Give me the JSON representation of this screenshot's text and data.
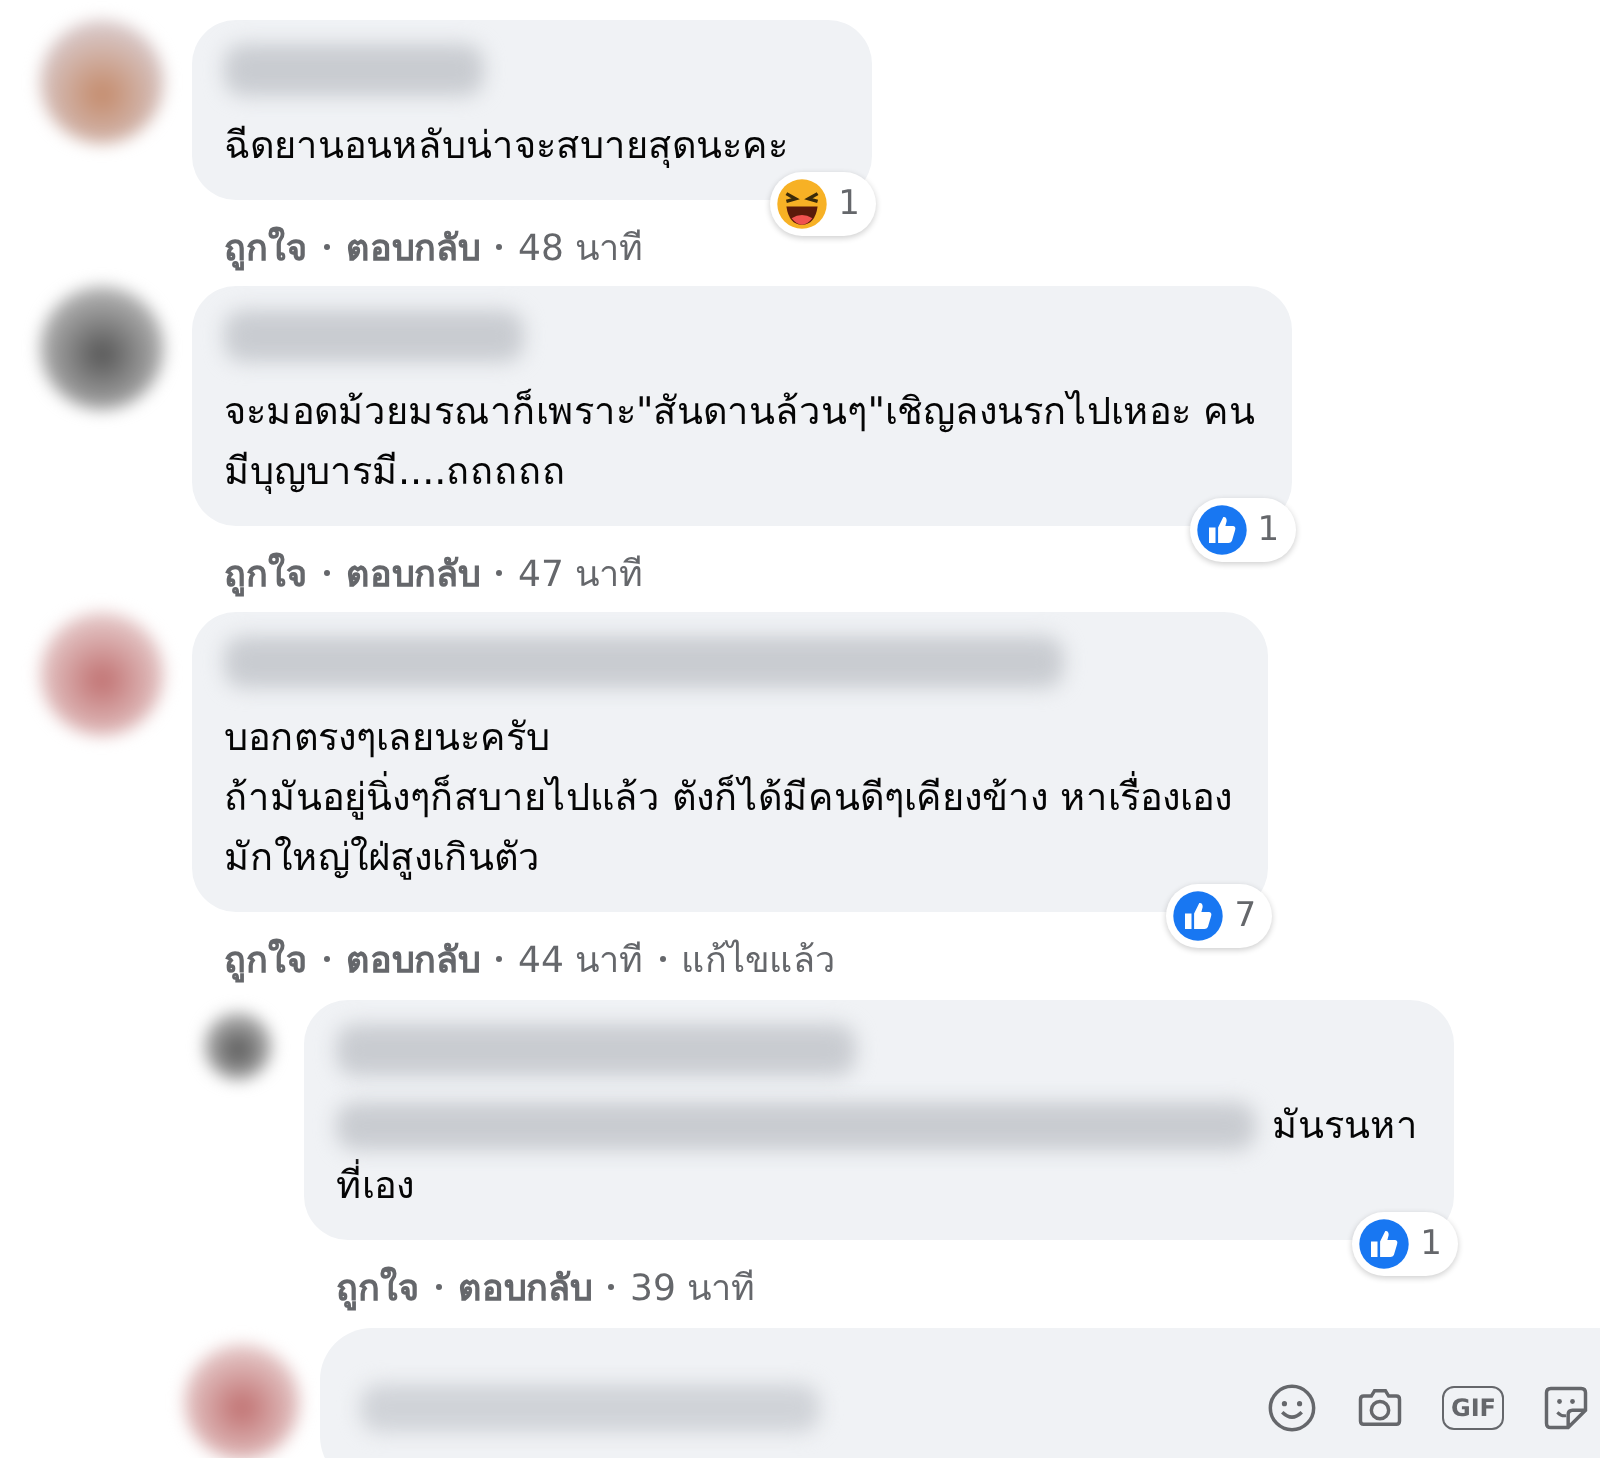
{
  "comments": [
    {
      "text_lines": [
        "ฉีดยานอนหลับน่าจะสบายสุดนะคะ"
      ],
      "reaction": {
        "kind": "haha",
        "count": "1"
      },
      "actions": [
        "ถูกใจ",
        "ตอบกลับ",
        "48 นาที"
      ]
    },
    {
      "text_lines": [
        "จะมอดม้วยมรณาก็เพราะ\"สันดานล้วนๆ\"เชิญลงนรกไปเหอะ คน",
        "มีบุญบารมี....ถถถถถ"
      ],
      "reaction": {
        "kind": "like",
        "count": "1"
      },
      "actions": [
        "ถูกใจ",
        "ตอบกลับ",
        "47 นาที"
      ]
    },
    {
      "text_lines": [
        "บอกตรงๆเลยนะครับ",
        "ถ้ามันอยู่นิ่งๆก็สบายไปแล้ว ตังก็ได้มีคนดีๆเคียงข้าง หาเรื่องเอง",
        "มักใหญ่ใฝ่สูงเกินตัว"
      ],
      "reaction": {
        "kind": "like",
        "count": "7"
      },
      "actions": [
        "ถูกใจ",
        "ตอบกลับ",
        "44 นาที",
        "แก้ไขแล้ว"
      ]
    }
  ],
  "reply": {
    "text_lines": [
      "มันรนหา",
      "ที่เอง"
    ],
    "reaction": {
      "kind": "like",
      "count": "1"
    },
    "actions": [
      "ถูกใจ",
      "ตอบกลับ",
      "39 นาที"
    ]
  },
  "composer": {
    "tools": [
      {
        "kind": "emoji"
      },
      {
        "kind": "camera"
      },
      {
        "kind": "gif",
        "label": "GIF"
      },
      {
        "kind": "sticker"
      }
    ]
  }
}
